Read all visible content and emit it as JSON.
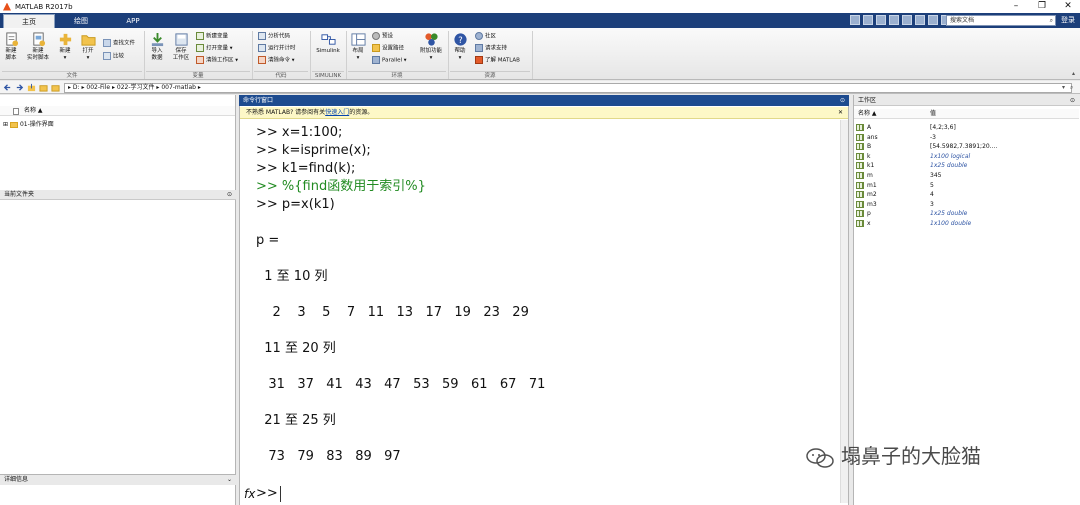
{
  "window": {
    "title": "MATLAB R2017b",
    "controls": [
      "–",
      "❐",
      "✕"
    ]
  },
  "tabs": [
    {
      "label": "主页",
      "active": true
    },
    {
      "label": "绘图"
    },
    {
      "label": "APP"
    }
  ],
  "search": {
    "placeholder": "搜索文档"
  },
  "login": "登录",
  "ribbon": {
    "new_script": [
      "新建",
      "脚本"
    ],
    "new_live": [
      "新建",
      "实时脚本"
    ],
    "new": "新建",
    "open": "打开",
    "find_files": "查找文件",
    "compare": "比较",
    "import": [
      "导入",
      "数据"
    ],
    "save_ws": [
      "保存",
      "工作区"
    ],
    "new_var": "新建变量",
    "open_var": "打开变量 ▾",
    "clear_ws": "清除工作区 ▾",
    "analyze": "分析代码",
    "run_time": "运行并计时",
    "clear_cmd": "清除命令 ▾",
    "simulink": "Simulink",
    "layout": "布局",
    "prefs": "预设",
    "set_path": "设置路径",
    "parallel": "Parallel ▾",
    "addons": "附加功能",
    "help": "帮助",
    "community": "社区",
    "support": "请求支持",
    "learn": "了解 MATLAB",
    "groups": [
      "文件",
      "变量",
      "代码",
      "SIMULINK",
      "环境",
      "资源"
    ]
  },
  "path": {
    "segments": "▸ D: ▸ 002-File ▸ 022-学习文件 ▸ 007-matlab ▸"
  },
  "current_folder": {
    "title": "当前文件夹",
    "column": "名称 ▲",
    "items": [
      {
        "name": "01-操作界面",
        "expander": "⊞"
      }
    ],
    "details": "详细信息"
  },
  "command_window": {
    "title": "命令行窗口",
    "banner_pre": "不熟悉 MATLAB? 请参阅有关",
    "banner_link": "快速入门",
    "banner_post": "的资源。",
    "lines": [
      ">> x=1:100;",
      ">> k=isprime(x);",
      ">> k1=find(k);",
      ">> %{find函数用于索引%}",
      ">> p=x(k1)",
      "p =",
      "  1 至 10 列",
      "    2    3    5    7   11   13   17   19   23   29",
      "  11 至 20 列",
      "   31   37   41   43   47   53   59   61   67   71",
      "  21 至 25 列",
      "   73   79   83   89   97"
    ],
    "fx": "fx",
    "prompt": ">>"
  },
  "workspace": {
    "title": "工作区",
    "col_name": "名称 ▲",
    "col_value": "值",
    "vars": [
      {
        "name": "A",
        "value": "[4,2;3,6]",
        "italic": false
      },
      {
        "name": "ans",
        "value": "-3",
        "italic": false
      },
      {
        "name": "B",
        "value": "[54.5982,7.3891;20....",
        "italic": false
      },
      {
        "name": "k",
        "value": "1x100 logical",
        "italic": true
      },
      {
        "name": "k1",
        "value": "1x25 double",
        "italic": true
      },
      {
        "name": "m",
        "value": "345",
        "italic": false
      },
      {
        "name": "m1",
        "value": "5",
        "italic": false
      },
      {
        "name": "m2",
        "value": "4",
        "italic": false
      },
      {
        "name": "m3",
        "value": "3",
        "italic": false
      },
      {
        "name": "p",
        "value": "1x25 double",
        "italic": true
      },
      {
        "name": "x",
        "value": "1x100 double",
        "italic": true
      }
    ]
  },
  "watermark": "塌鼻子的大脸猫"
}
